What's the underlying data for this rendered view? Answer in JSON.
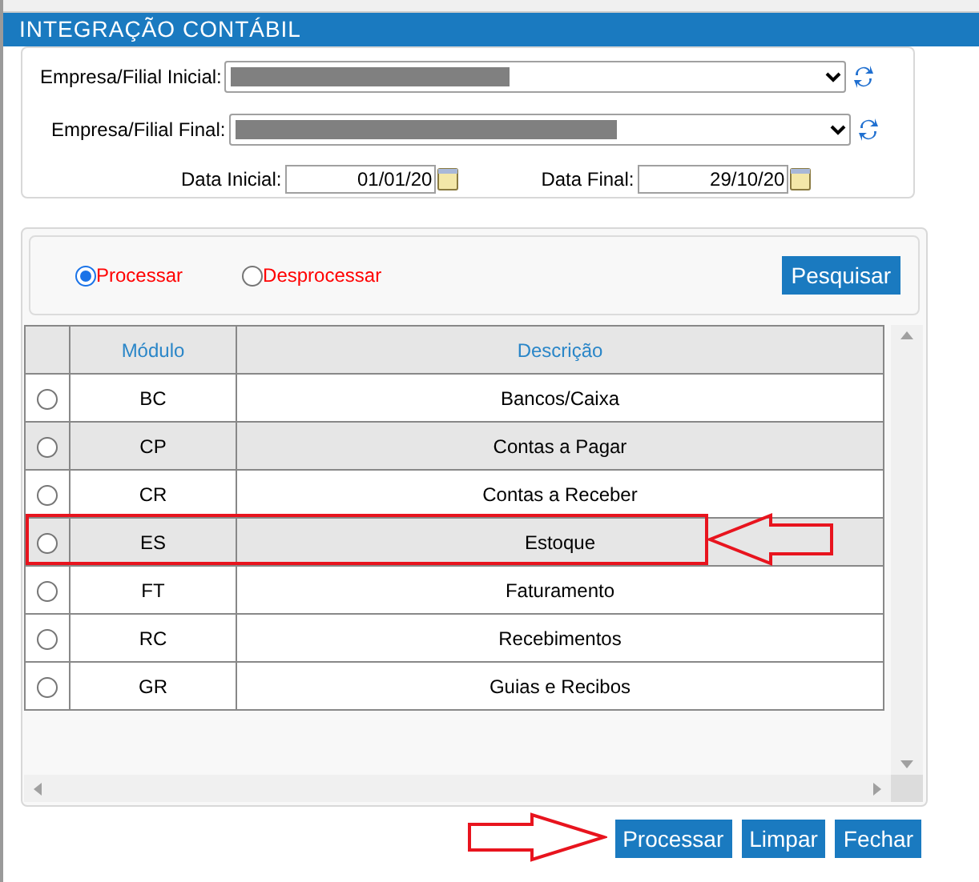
{
  "title": "INTEGRAÇÃO CONTÁBIL",
  "filters": {
    "company_start_label": "Empresa/Filial Inicial:",
    "company_end_label": "Empresa/Filial Final:",
    "date_start_label": "Data Inicial:",
    "date_start": "01/01/20",
    "date_end_label": "Data Final:",
    "date_end": "29/10/20"
  },
  "mode_options": [
    {
      "label": "Processar",
      "selected": true
    },
    {
      "label": "Desprocessar",
      "selected": false
    }
  ],
  "search_button": "Pesquisar",
  "table": {
    "columns": [
      "Módulo",
      "Descrição"
    ],
    "rows": [
      {
        "module": "BC",
        "description": "Bancos/Caixa",
        "selected": false,
        "shaded": false
      },
      {
        "module": "CP",
        "description": "Contas a Pagar",
        "selected": false,
        "shaded": true
      },
      {
        "module": "CR",
        "description": "Contas a Receber",
        "selected": false,
        "shaded": false
      },
      {
        "module": "ES",
        "description": "Estoque",
        "selected": false,
        "shaded": true
      },
      {
        "module": "FT",
        "description": "Faturamento",
        "selected": false,
        "shaded": false
      },
      {
        "module": "RC",
        "description": "Recebimentos",
        "selected": false,
        "shaded": false
      },
      {
        "module": "GR",
        "description": "Guias e Recibos",
        "selected": false,
        "shaded": false
      }
    ]
  },
  "buttons": [
    "Processar",
    "Limpar",
    "Fechar"
  ]
}
